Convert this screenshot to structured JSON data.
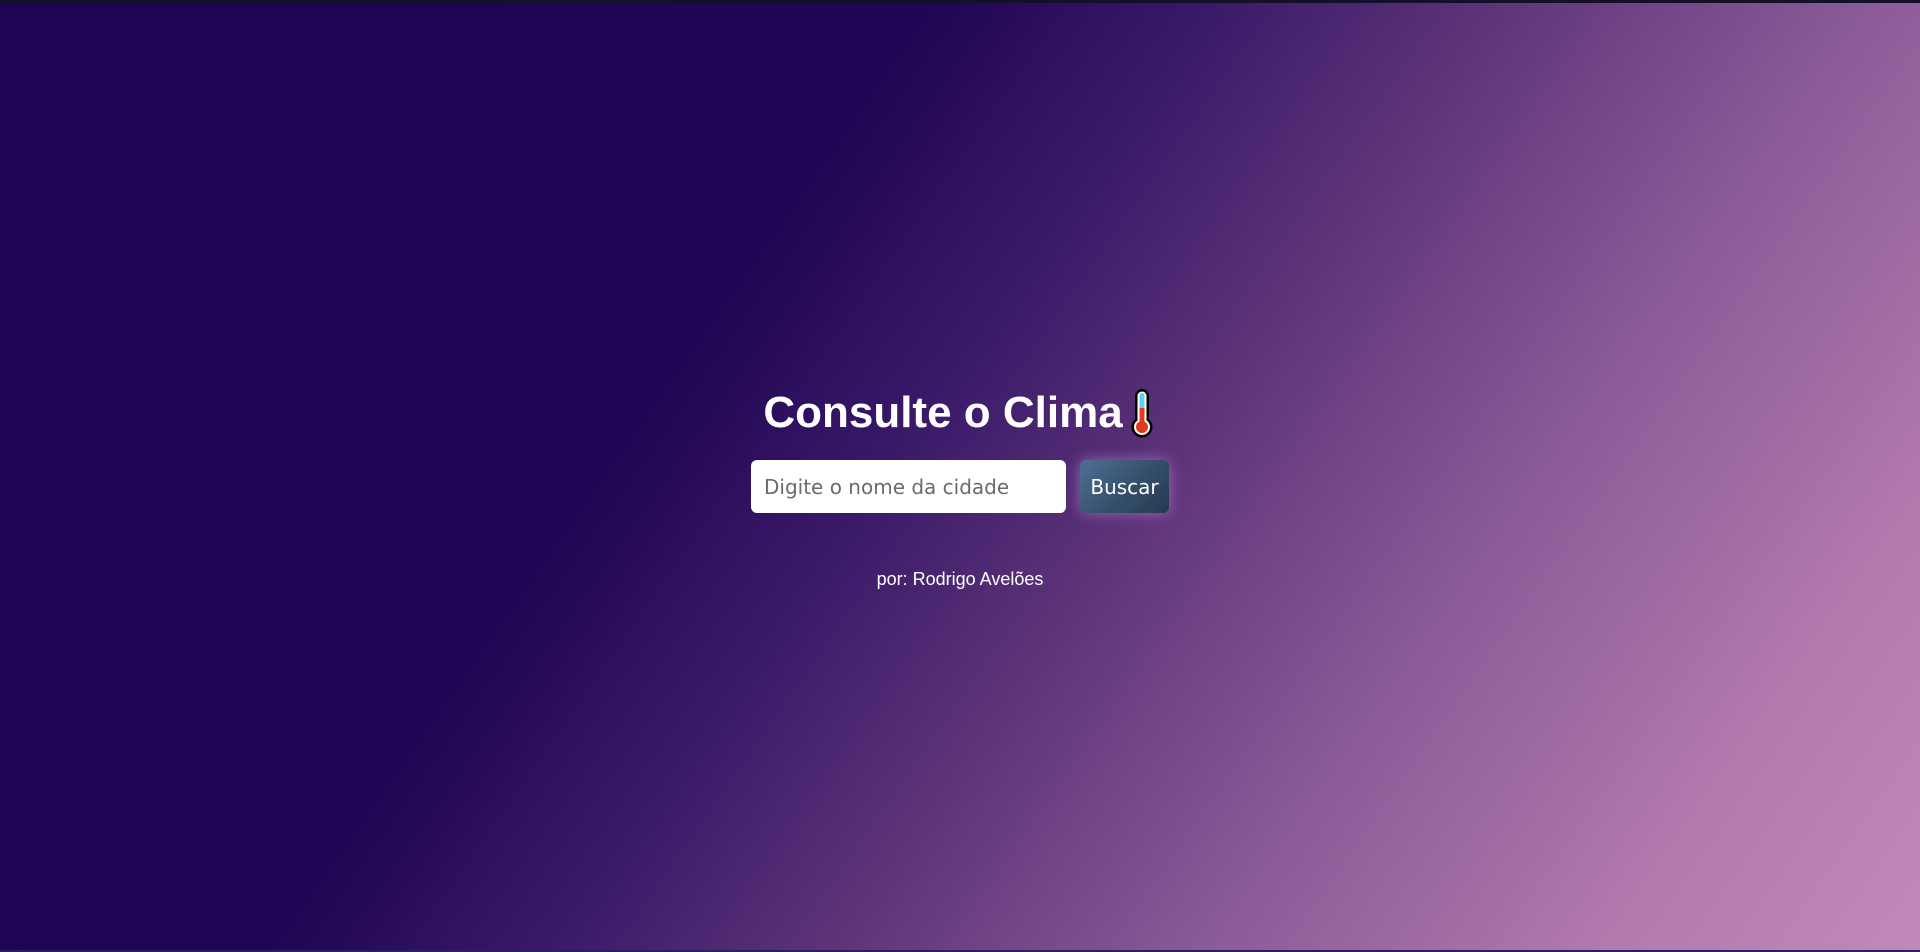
{
  "header": {
    "title": "Consulte o Clima",
    "title_icon": "thermometer-icon"
  },
  "search": {
    "placeholder": "Digite o nome da cidade",
    "value": "",
    "button_label": "Buscar"
  },
  "footer": {
    "credit": "por: Rodrigo Avelões"
  },
  "colors": {
    "background_start": "#1e0452",
    "background_end": "#c288b9",
    "button_start": "#4f6f93",
    "button_end": "#26384f",
    "text": "#ffffff"
  }
}
